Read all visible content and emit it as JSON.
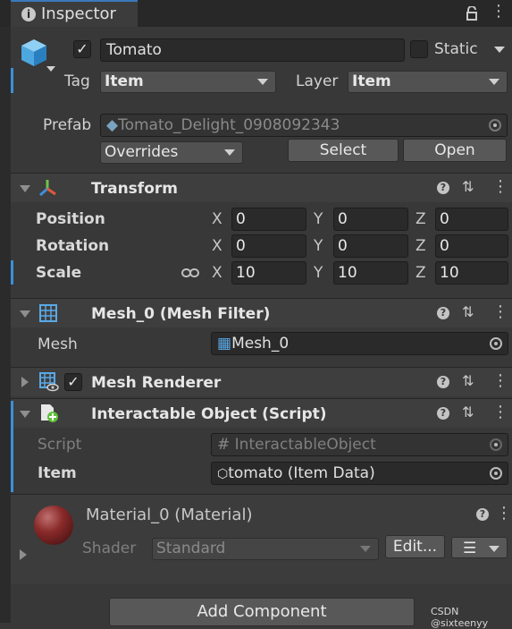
{
  "tab": {
    "title": "Inspector"
  },
  "object": {
    "name": "Tomato",
    "enabled": true,
    "static_label": "Static",
    "static_checked": false
  },
  "tag": {
    "label": "Tag",
    "value": "Item"
  },
  "layer": {
    "label": "Layer",
    "value": "Item"
  },
  "prefab": {
    "label": "Prefab",
    "asset": "Tomato_Delight_0908092343",
    "overrides": "Overrides",
    "select": "Select",
    "open": "Open"
  },
  "transform": {
    "title": "Transform",
    "rows": [
      {
        "label": "Position",
        "x": "0",
        "y": "0",
        "z": "0"
      },
      {
        "label": "Rotation",
        "x": "0",
        "y": "0",
        "z": "0"
      },
      {
        "label": "Scale",
        "x": "10",
        "y": "10",
        "z": "10"
      }
    ],
    "axes": [
      "X",
      "Y",
      "Z"
    ]
  },
  "mesh_filter": {
    "title": "Mesh_0 (Mesh Filter)",
    "mesh_label": "Mesh",
    "mesh_value": "Mesh_0"
  },
  "mesh_renderer": {
    "title": "Mesh Renderer",
    "enabled": true
  },
  "script_component": {
    "title": "Interactable Object (Script)",
    "script_label": "Script",
    "script_value": "InteractableObject",
    "item_label": "Item",
    "item_value": "tomato (Item Data)"
  },
  "material": {
    "title": "Material_0 (Material)",
    "shader_label": "Shader",
    "shader_value": "Standard",
    "edit": "Edit..."
  },
  "add_component": "Add Component",
  "watermark": "CSDN @sixteenyy",
  "colors": {
    "accent": "#3d8fdb",
    "panel": "#383838",
    "header": "#3e3e3e",
    "field": "#2a2a2a"
  }
}
